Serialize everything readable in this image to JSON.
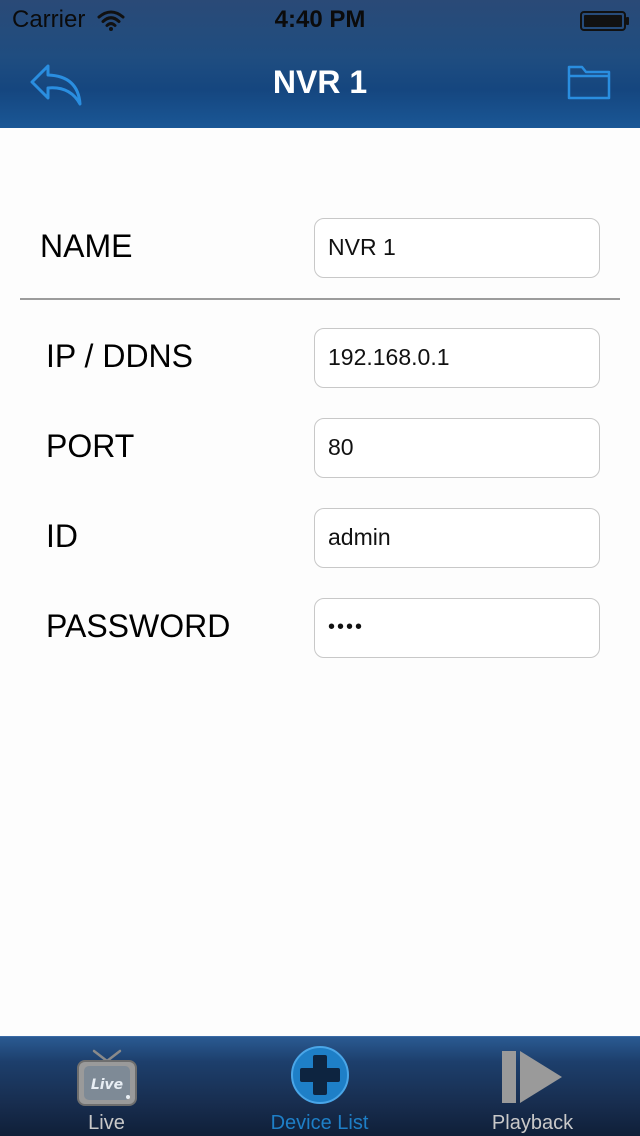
{
  "status_bar": {
    "carrier": "Carrier",
    "time": "4:40 PM"
  },
  "nav": {
    "title": "NVR 1",
    "back_icon": "back-arrow-icon",
    "right_icon": "folder-icon"
  },
  "form": {
    "name": {
      "label": "NAME",
      "value": "NVR 1"
    },
    "ip": {
      "label": "IP / DDNS",
      "value": "192.168.0.1"
    },
    "port": {
      "label": "PORT",
      "value": "80"
    },
    "id": {
      "label": "ID",
      "value": "admin"
    },
    "password": {
      "label": "PASSWORD",
      "value": "••••"
    }
  },
  "tabs": [
    {
      "label": "Live",
      "icon": "live-tv-icon",
      "active": false
    },
    {
      "label": "Device List",
      "icon": "plus-circle-icon",
      "active": true
    },
    {
      "label": "Playback",
      "icon": "playback-icon",
      "active": false
    }
  ],
  "colors": {
    "nav_background": "#1f4d80",
    "accent": "#1e7fc7",
    "tab_inactive": "#c9c9c9"
  }
}
